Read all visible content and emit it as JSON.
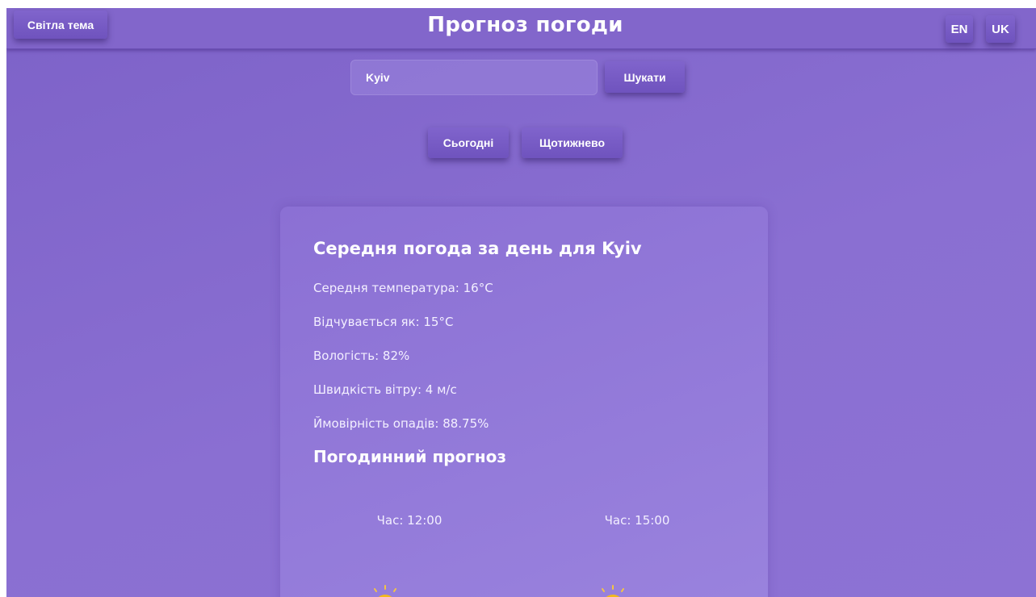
{
  "header": {
    "theme_toggle_label": "Світла тема",
    "title": "Прогноз погоди",
    "languages": [
      "EN",
      "UK"
    ]
  },
  "search": {
    "value": "Kyiv",
    "button_label": "Шукати"
  },
  "tabs": [
    "Сьогодні",
    "Щотижнево"
  ],
  "daily": {
    "title": "Середня погода за день для Kyiv",
    "stats": [
      "Середня температура: 16°C",
      "Відчувається як: 15°C",
      "Вологість: 82%",
      "Швидкість вітру: 4 м/с",
      "Ймовірність опадів: 88.75%"
    ]
  },
  "hourly": {
    "title": "Погодинний прогноз",
    "entries": [
      {
        "time_label": "Час: 12:00",
        "icon": "partly-cloudy-icon"
      },
      {
        "time_label": "Час: 15:00",
        "icon": "partly-cloudy-icon"
      }
    ]
  }
}
